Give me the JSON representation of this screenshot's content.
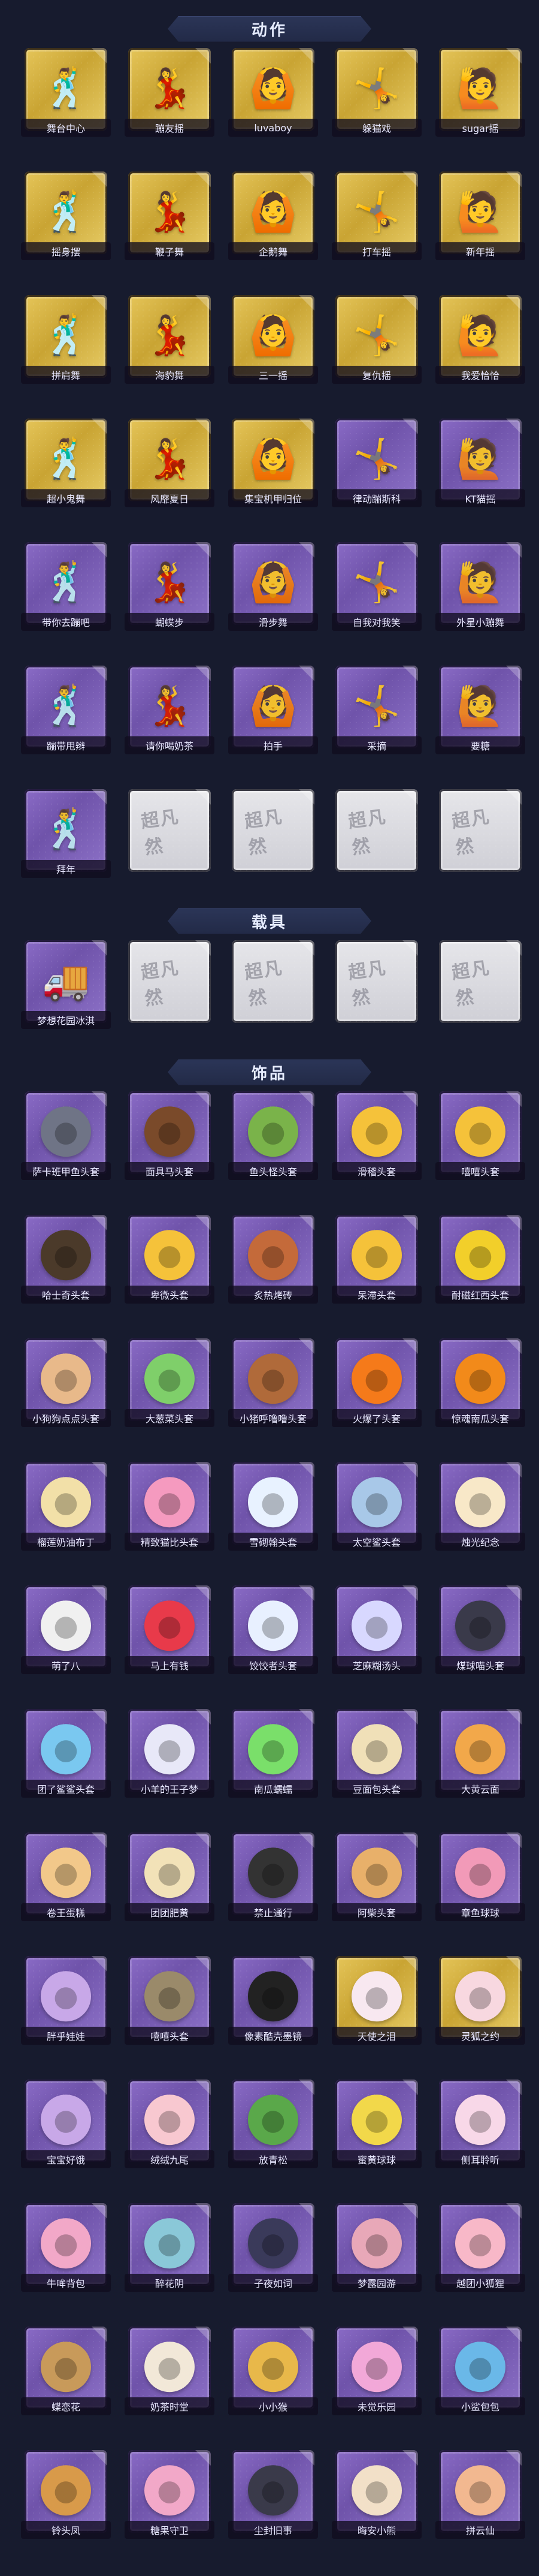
{
  "sections": [
    {
      "title": "动作",
      "kind": "pose",
      "items": [
        {
          "label": "舞台中心",
          "style": "gold",
          "icon": "dance-pose-icon"
        },
        {
          "label": "蹦友摇",
          "style": "gold",
          "icon": "dance-pose-icon"
        },
        {
          "label": "luvaboy",
          "style": "gold",
          "icon": "dance-pose-icon"
        },
        {
          "label": "躲猫戏",
          "style": "gold",
          "icon": "dance-pose-icon"
        },
        {
          "label": "sugar摇",
          "style": "gold",
          "icon": "dance-pose-icon"
        },
        {
          "label": "摇身摆",
          "style": "gold",
          "icon": "dance-pose-icon"
        },
        {
          "label": "鞭子舞",
          "style": "gold",
          "icon": "dance-pose-icon"
        },
        {
          "label": "企鹅舞",
          "style": "gold",
          "icon": "dance-pose-icon"
        },
        {
          "label": "打车摇",
          "style": "gold",
          "icon": "dance-pose-icon"
        },
        {
          "label": "新年摇",
          "style": "gold",
          "icon": "dance-pose-icon"
        },
        {
          "label": "拼肩舞",
          "style": "gold",
          "icon": "dance-pose-icon"
        },
        {
          "label": "海豹舞",
          "style": "gold",
          "icon": "dance-pose-icon"
        },
        {
          "label": "三一摇",
          "style": "gold",
          "icon": "dance-pose-icon"
        },
        {
          "label": "复仇摇",
          "style": "gold",
          "icon": "dance-pose-icon"
        },
        {
          "label": "我爱恰恰",
          "style": "gold",
          "icon": "dance-pose-icon"
        },
        {
          "label": "超小鬼舞",
          "style": "gold",
          "icon": "dance-pose-icon"
        },
        {
          "label": "风靡夏日",
          "style": "gold",
          "icon": "dance-pose-icon"
        },
        {
          "label": "集宝机甲归位",
          "style": "gold",
          "icon": "dance-pose-icon"
        },
        {
          "label": "律动蹦斯科",
          "style": "purple",
          "icon": "dance-pose-icon"
        },
        {
          "label": "KT猫摇",
          "style": "purple",
          "icon": "dance-pose-icon"
        },
        {
          "label": "带你去蹦吧",
          "style": "purple",
          "icon": "dance-pose-icon"
        },
        {
          "label": "蝴蝶步",
          "style": "purple",
          "icon": "dance-pose-icon"
        },
        {
          "label": "滑步舞",
          "style": "purple",
          "icon": "dance-pose-icon"
        },
        {
          "label": "自我对我笑",
          "style": "purple",
          "icon": "dance-pose-icon"
        },
        {
          "label": "外星小蹦舞",
          "style": "purple",
          "icon": "dance-pose-icon"
        },
        {
          "label": "蹦带甩辫",
          "style": "purple",
          "icon": "dance-pose-icon"
        },
        {
          "label": "请你喝奶茶",
          "style": "purple",
          "icon": "dance-pose-icon"
        },
        {
          "label": "拍手",
          "style": "purple",
          "icon": "dance-pose-icon"
        },
        {
          "label": "采摘",
          "style": "purple",
          "icon": "dance-pose-icon"
        },
        {
          "label": "要糖",
          "style": "purple",
          "icon": "dance-pose-icon"
        },
        {
          "label": "拜年",
          "style": "purple",
          "icon": "dance-pose-icon"
        },
        {
          "label": "",
          "style": "locked",
          "icon": "locked-icon"
        },
        {
          "label": "",
          "style": "locked",
          "icon": "locked-icon"
        },
        {
          "label": "",
          "style": "locked",
          "icon": "locked-icon"
        },
        {
          "label": "",
          "style": "locked",
          "icon": "locked-icon"
        }
      ]
    },
    {
      "title": "载具",
      "kind": "vehicle",
      "items": [
        {
          "label": "梦想花园冰淇",
          "style": "purple",
          "icon": "ice-cream-truck-icon"
        },
        {
          "label": "",
          "style": "locked",
          "icon": "locked-icon"
        },
        {
          "label": "",
          "style": "locked",
          "icon": "locked-icon"
        },
        {
          "label": "",
          "style": "locked",
          "icon": "locked-icon"
        },
        {
          "label": "",
          "style": "locked",
          "icon": "locked-icon"
        }
      ]
    },
    {
      "title": "饰品",
      "kind": "accessory",
      "items": [
        {
          "label": "萨卡班甲鱼头套",
          "style": "purple",
          "icon": "fish-head-icon",
          "color": "#6f7486"
        },
        {
          "label": "面具马头套",
          "style": "purple",
          "icon": "horse-head-icon",
          "color": "#7a4a2a"
        },
        {
          "label": "鱼头怪头套",
          "style": "purple",
          "icon": "fish-monster-icon",
          "color": "#7ab34a"
        },
        {
          "label": "滑稽头套",
          "style": "purple",
          "icon": "smile-face-icon",
          "color": "#f5c23a"
        },
        {
          "label": "嘻嘻头套",
          "style": "purple",
          "icon": "grin-face-icon",
          "color": "#f5c23a"
        },
        {
          "label": "哈士奇头套",
          "style": "purple",
          "icon": "husky-icon",
          "color": "#4b3a2a"
        },
        {
          "label": "卑微头套",
          "style": "purple",
          "icon": "sad-face-icon",
          "color": "#f5c23a"
        },
        {
          "label": "炙热烤砖",
          "style": "purple",
          "icon": "brick-icon",
          "color": "#c46a3a"
        },
        {
          "label": "呆滞头套",
          "style": "purple",
          "icon": "dazed-face-icon",
          "color": "#f5c23a"
        },
        {
          "label": "耐磁红西头套",
          "style": "purple",
          "icon": "pikachu-icon",
          "color": "#f2cf2a"
        },
        {
          "label": "小狗狗点点头套",
          "style": "purple",
          "icon": "pig-face-icon",
          "color": "#e8b98a"
        },
        {
          "label": "大葱菜头套",
          "style": "purple",
          "icon": "bokchoy-icon",
          "color": "#7fcf6a"
        },
        {
          "label": "小猪呼噜噜头套",
          "style": "purple",
          "icon": "cookie-pig-icon",
          "color": "#b06a3a"
        },
        {
          "label": "火爆了头套",
          "style": "purple",
          "icon": "fire-icon",
          "color": "#f57a1a"
        },
        {
          "label": "惊魂南瓜头套",
          "style": "purple",
          "icon": "pumpkin-icon",
          "color": "#f28a1a"
        },
        {
          "label": "榴莲奶油布丁",
          "style": "purple",
          "icon": "pudding-icon",
          "color": "#f2e0a8"
        },
        {
          "label": "精致猫比头套",
          "style": "purple",
          "icon": "pink-bear-icon",
          "color": "#f59abf"
        },
        {
          "label": "雪砌翰头套",
          "style": "purple",
          "icon": "snow-cat-icon",
          "color": "#e8f2ff"
        },
        {
          "label": "太空鲨头套",
          "style": "purple",
          "icon": "shark-icon",
          "color": "#a8c8e8"
        },
        {
          "label": "烛光纪念",
          "style": "purple",
          "icon": "candle-icon",
          "color": "#f8e8c8"
        },
        {
          "label": "萌了八",
          "style": "purple",
          "icon": "radish-icon",
          "color": "#f0f0f0"
        },
        {
          "label": "马上有钱",
          "style": "purple",
          "icon": "red-bird-icon",
          "color": "#e83a4a"
        },
        {
          "label": "饺饺者头套",
          "style": "purple",
          "icon": "dumpling-icon",
          "color": "#e8f0ff"
        },
        {
          "label": "芝麻糊汤头",
          "style": "purple",
          "icon": "cloud-face-icon",
          "color": "#d8d8ff"
        },
        {
          "label": "煤球喵头套",
          "style": "purple",
          "icon": "black-cat-icon",
          "color": "#3a3a4a"
        },
        {
          "label": "团了鲨鲨头套",
          "style": "purple",
          "icon": "blue-shark-icon",
          "color": "#7ac8f0"
        },
        {
          "label": "小羊的王子梦",
          "style": "purple",
          "icon": "sheep-icon",
          "color": "#e8e8f8"
        },
        {
          "label": "南瓜蠕蠕",
          "style": "purple",
          "icon": "green-slime-icon",
          "color": "#7adf6a"
        },
        {
          "label": "豆面包头套",
          "style": "purple",
          "icon": "bread-face-icon",
          "color": "#f0e0b8"
        },
        {
          "label": "大黄云面",
          "style": "purple",
          "icon": "orange-face-icon",
          "color": "#f2a84a"
        },
        {
          "label": "卷王蛋糕",
          "style": "purple",
          "icon": "cake-roll-icon",
          "color": "#f2c88a"
        },
        {
          "label": "团团肥黄",
          "style": "purple",
          "icon": "hamster-icon",
          "color": "#f2e2b8"
        },
        {
          "label": "禁止通行",
          "style": "purple",
          "icon": "traffic-cone-icon",
          "color": "#333333"
        },
        {
          "label": "阿柴头套",
          "style": "purple",
          "icon": "shiba-icon",
          "color": "#e8b06a"
        },
        {
          "label": "章鱼球球",
          "style": "purple",
          "icon": "octopus-icon",
          "color": "#f29ab8"
        },
        {
          "label": "胖乎娃娃",
          "style": "purple",
          "icon": "baby-doll-icon",
          "color": "#c8a8e8"
        },
        {
          "label": "嘻嘻头套",
          "style": "purple",
          "icon": "tabby-cat-icon",
          "color": "#9a8a6a"
        },
        {
          "label": "像素酷壳墨镜",
          "style": "purple",
          "icon": "pixel-sunglasses-icon",
          "color": "#222222"
        },
        {
          "label": "天使之泪",
          "style": "gold",
          "icon": "angel-icon",
          "color": "#f8e8f0"
        },
        {
          "label": "灵狐之约",
          "style": "gold",
          "icon": "fox-spirit-icon",
          "color": "#f8d8e0"
        },
        {
          "label": "宝宝好饿",
          "style": "purple",
          "icon": "baby-hungry-icon",
          "color": "#c8a8e8"
        },
        {
          "label": "绒绒九尾",
          "style": "purple",
          "icon": "nine-tail-fox-icon",
          "color": "#f8c8d0"
        },
        {
          "label": "放青松",
          "style": "purple",
          "icon": "bonsai-icon",
          "color": "#5aa84a"
        },
        {
          "label": "蜜黄球球",
          "style": "purple",
          "icon": "yellow-chick-icon",
          "color": "#f2d84a"
        },
        {
          "label": "侧耳聆听",
          "style": "purple",
          "icon": "lotus-icon",
          "color": "#f8d8e8"
        },
        {
          "label": "牛哞背包",
          "style": "purple",
          "icon": "pink-cow-icon",
          "color": "#f2a8c8"
        },
        {
          "label": "醉花阴",
          "style": "purple",
          "icon": "sakura-doll-icon",
          "color": "#8ac8d8"
        },
        {
          "label": "子夜如词",
          "style": "purple",
          "icon": "night-lady-icon",
          "color": "#3a3a5a"
        },
        {
          "label": "梦露园游",
          "style": "purple",
          "icon": "flower-girl-icon",
          "color": "#e8a8b8"
        },
        {
          "label": "越团小狐狸",
          "style": "purple",
          "icon": "pink-fox-icon",
          "color": "#f8b8c8"
        },
        {
          "label": "蝶恋花",
          "style": "purple",
          "icon": "butterfly-charm-icon",
          "color": "#c89a5a"
        },
        {
          "label": "奶茶时堂",
          "style": "purple",
          "icon": "milk-tea-charm-icon",
          "color": "#f2e8d8"
        },
        {
          "label": "小小猴",
          "style": "purple",
          "icon": "monkey-icon",
          "color": "#e8b84a"
        },
        {
          "label": "未觉乐园",
          "style": "purple",
          "icon": "fairy-girl-icon",
          "color": "#f2a8d8"
        },
        {
          "label": "小鲨包包",
          "style": "purple",
          "icon": "blue-shark-bag-icon",
          "color": "#6ab8e8"
        },
        {
          "label": "铃头凤",
          "style": "purple",
          "icon": "phoenix-doll-icon",
          "color": "#d89a4a"
        },
        {
          "label": "糖果守卫",
          "style": "purple",
          "icon": "candy-doll-icon",
          "color": "#f2a8c8"
        },
        {
          "label": "尘封旧事",
          "style": "purple",
          "icon": "dark-doll-icon",
          "color": "#3a3a4a"
        },
        {
          "label": "晦安小熊",
          "style": "purple",
          "icon": "bear-doll-icon",
          "color": "#f2e0c8"
        },
        {
          "label": "拼云仙",
          "style": "purple",
          "icon": "cloud-fairy-icon",
          "color": "#f2b890"
        }
      ]
    }
  ],
  "locked_watermark": "超凡然"
}
